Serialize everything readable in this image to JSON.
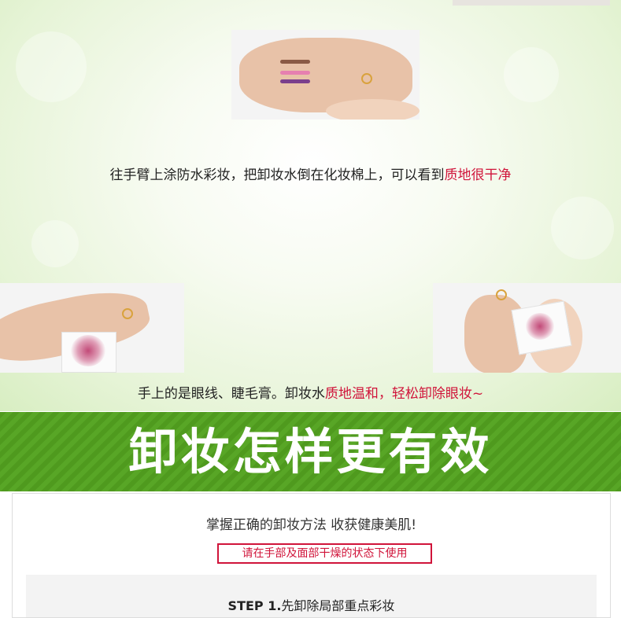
{
  "caption1": {
    "text": "往手臂上涂防水彩妆，把卸妆水倒在化妆棉上，可以看到",
    "highlight": "质地很干净"
  },
  "caption2": {
    "text": "手上的是眼线、睫毛膏。卸妆水",
    "highlight": "质地温和，轻松卸除眼妆~"
  },
  "banner": {
    "title": "卸妆怎样更有效"
  },
  "method": {
    "tagline": "掌握正确的卸妆方法 收获健康美肌!",
    "warning": "请在手部及面部干燥的状态下使用",
    "step_label": "STEP 1.",
    "step_text": "先卸除局部重点彩妆"
  },
  "colors": {
    "highlight": "#d0143a",
    "banner_green": "#4f9a1e",
    "background_tint": "#d8eec2"
  }
}
